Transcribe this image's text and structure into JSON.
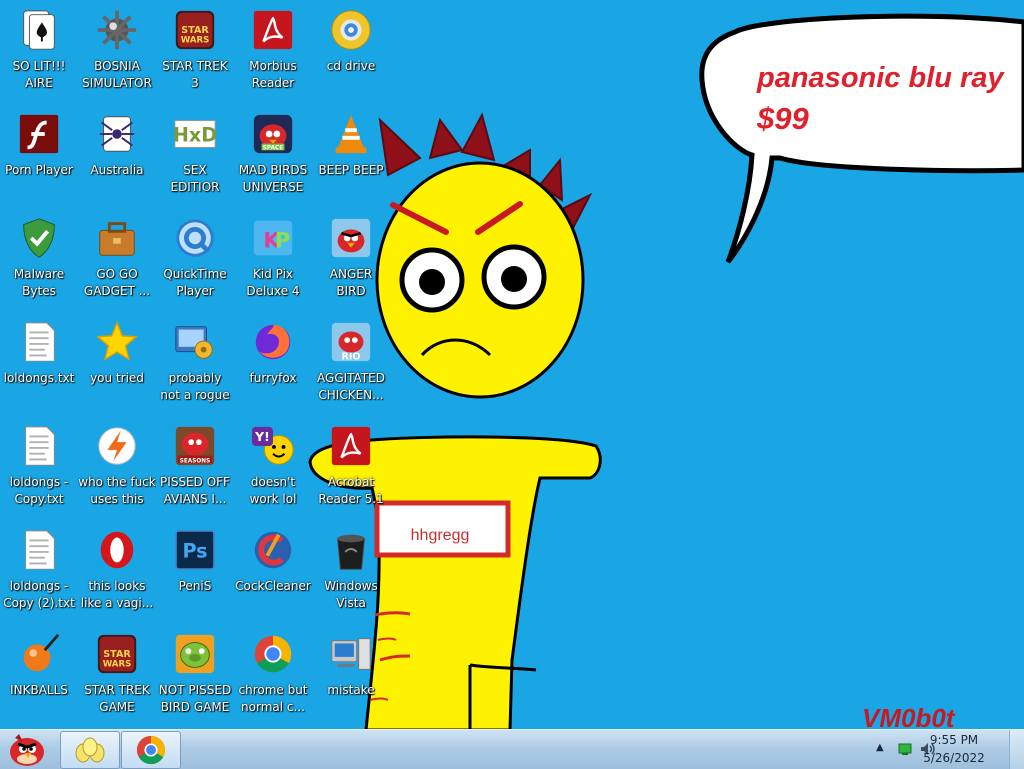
{
  "wallpaper": {
    "bubble_line1": "panasonic blu ray",
    "bubble_line2": "$99",
    "sign_text": "hhgregg",
    "watermark": "VM0b0t"
  },
  "desktop_icons": [
    {
      "label": "SO LIT!!!\nAIRE",
      "icon": "solitaire-icon"
    },
    {
      "label": "BOSNIA\nSIMULATOR",
      "icon": "minesweeper-icon"
    },
    {
      "label": "STAR TREK\n3",
      "icon": "star-wars-game-icon"
    },
    {
      "label": "Morbius\nReader",
      "icon": "adobe-reader-icon"
    },
    {
      "label": "cd drive",
      "icon": "cd-drive-icon"
    },
    {
      "label": "Porn Player",
      "icon": "flash-player-icon"
    },
    {
      "label": "Australia",
      "icon": "spider-solitaire-icon"
    },
    {
      "label": "SEX\nEDITIOR",
      "icon": "hxd-editor-icon"
    },
    {
      "label": "MAD BIRDS\nUNIVERSE",
      "icon": "angry-birds-space-icon"
    },
    {
      "label": "BEEP BEEP",
      "icon": "vlc-icon"
    },
    {
      "label": "Malware\nBytes",
      "icon": "shield-icon"
    },
    {
      "label": "GO GO\nGADGET ...",
      "icon": "toolbox-icon"
    },
    {
      "label": "QuickTime\nPlayer",
      "icon": "quicktime-icon"
    },
    {
      "label": "Kid Pix\nDeluxe 4",
      "icon": "kid-pix-icon"
    },
    {
      "label": "ANGER\nBIRD",
      "icon": "angry-bird-icon"
    },
    {
      "label": "loldongs.txt",
      "icon": "text-file-icon"
    },
    {
      "label": "you tried",
      "icon": "star-icon"
    },
    {
      "label": "probably\nnot a rogue",
      "icon": "system-tool-icon"
    },
    {
      "label": "furryfox",
      "icon": "firefox-icon"
    },
    {
      "label": "AGGITATED\nCHICKEN...",
      "icon": "angry-birds-rio-icon"
    },
    {
      "label": "loldongs -\nCopy.txt",
      "icon": "text-file-icon"
    },
    {
      "label": "who the fuck\nuses this",
      "icon": "avast-icon"
    },
    {
      "label": "PISSED OFF\nAVIANS I...",
      "icon": "angry-birds-seasons-icon"
    },
    {
      "label": "doesn't\nwork lol",
      "icon": "yahoo-messenger-icon"
    },
    {
      "label": "Acrobat\nReader 5.1",
      "icon": "acrobat-icon"
    },
    {
      "label": "loldongs -\nCopy (2).txt",
      "icon": "text-file-icon"
    },
    {
      "label": "this looks\nlike a vagi...",
      "icon": "opera-icon"
    },
    {
      "label": "PeniS",
      "icon": "photoshop-icon"
    },
    {
      "label": "CockCleaner",
      "icon": "ccleaner-icon"
    },
    {
      "label": "Windows\nVista",
      "icon": "trash-can-icon"
    },
    {
      "label": "INKBALLS",
      "icon": "inkball-icon"
    },
    {
      "label": "STAR TREK\nGAME",
      "icon": "star-wars-game-icon"
    },
    {
      "label": "NOT PISSED\nBIRD GAME",
      "icon": "bad-piggies-icon"
    },
    {
      "label": "chrome but\nnormal c...",
      "icon": "chrome-icon"
    },
    {
      "label": "mistake",
      "icon": "computer-icon"
    }
  ],
  "taskbar": {
    "start_icon": "angry-bird-start-icon",
    "pinned": [
      {
        "name": "birds-eggs-icon"
      },
      {
        "name": "chrome-icon"
      }
    ],
    "tray": {
      "time": "9:55 PM",
      "date": "5/26/2022",
      "icons": [
        "show-hidden-icons-chevron",
        "network-icon",
        "volume-icon"
      ]
    }
  },
  "colors": {
    "desktop_bg": "#1aa6e4",
    "creature_yellow": "#fff200",
    "bubble_text_red": "#e0202a",
    "sign_border": "#d42a2a"
  }
}
